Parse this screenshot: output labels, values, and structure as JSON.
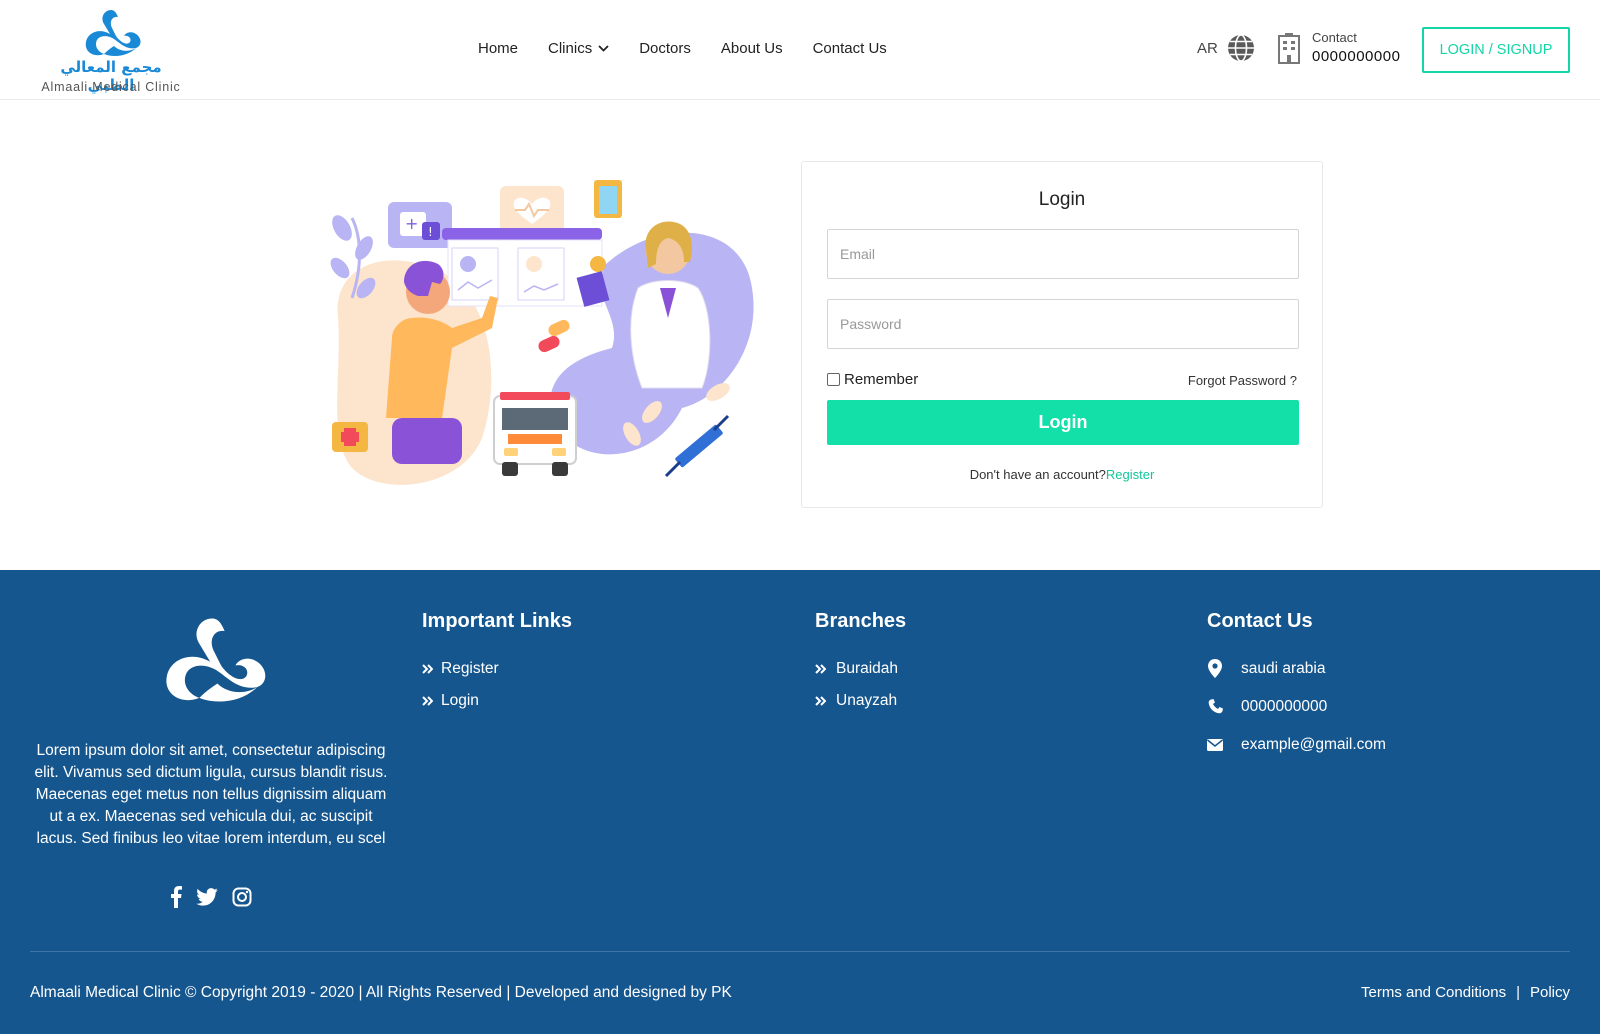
{
  "header": {
    "logo_arabic": "مجمع المعالي الطبي",
    "logo_english": "Almaali Medical Clinic",
    "nav": [
      {
        "label": "Home"
      },
      {
        "label": "Clinics",
        "has_dropdown": true
      },
      {
        "label": "Doctors"
      },
      {
        "label": "About Us"
      },
      {
        "label": "Contact Us"
      }
    ],
    "language": "AR",
    "contact_label": "Contact",
    "contact_phone": "0000000000",
    "login_signup": "LOGIN / SIGNUP"
  },
  "login": {
    "title": "Login",
    "email_placeholder": "Email",
    "password_placeholder": "Password",
    "remember_label": "Remember",
    "remember_checked": false,
    "forgot_password": "Forgot Password ?",
    "submit_label": "Login",
    "no_account_text": "Don't have an account?",
    "register_link": "Register"
  },
  "footer": {
    "description": "Lorem ipsum dolor sit amet, consectetur adipiscing elit. Vivamus sed dictum ligula, cursus blandit risus. Maecenas eget metus non tellus dignissim aliquam ut a ex. Maecenas sed vehicula dui, ac suscipit lacus. Sed finibus leo vitae lorem interdum, eu scel",
    "important_links": {
      "title": "Important Links",
      "items": [
        "Register",
        "Login"
      ]
    },
    "branches": {
      "title": "Branches",
      "items": [
        "Buraidah",
        "Unayzah"
      ]
    },
    "contact": {
      "title": "Contact Us",
      "location": "saudi arabia",
      "phone": "0000000000",
      "email": "example@gmail.com"
    },
    "copyright": "Almaali Medical Clinic © Copyright 2019 - 2020 | All Rights Reserved | Developed and designed by PK",
    "terms": "Terms and Conditions",
    "separator": "|",
    "policy": "Policy"
  },
  "colors": {
    "accent": "#12e0a8",
    "footer_bg": "#16568e",
    "brand_blue": "#1b8ad6"
  },
  "icons": [
    "globe-icon",
    "building-icon",
    "chevron-down-icon",
    "double-chevron-icon",
    "map-pin-icon",
    "phone-icon",
    "envelope-icon",
    "facebook-icon",
    "twitter-icon",
    "instagram-icon"
  ]
}
